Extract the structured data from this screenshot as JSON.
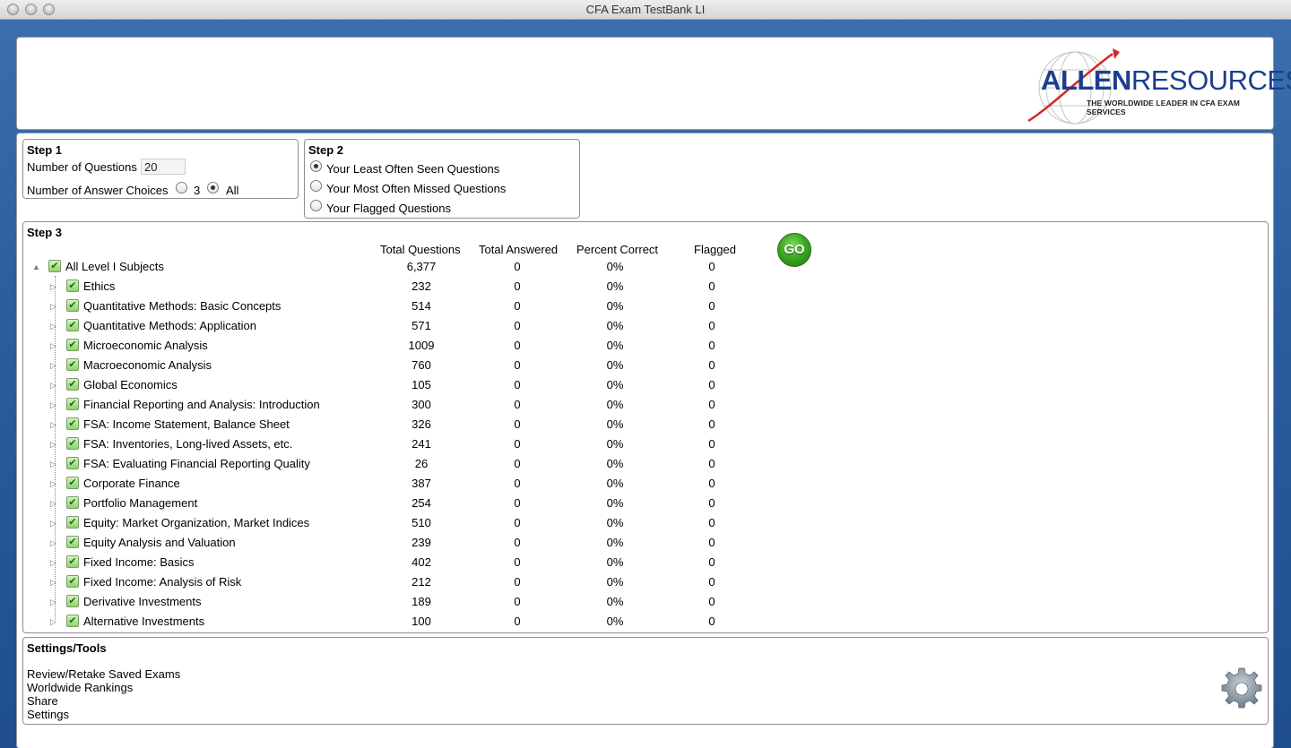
{
  "window": {
    "title": "CFA Exam TestBank LI"
  },
  "logo": {
    "brand_bold": "ALLEN",
    "brand_light": "RESOURCES",
    "tagline": "THE WORLDWIDE LEADER IN CFA EXAM SERVICES"
  },
  "step1": {
    "title": "Step 1",
    "num_questions_label": "Number of Questions",
    "num_questions_value": "20",
    "answer_choices_label": "Number of Answer Choices",
    "choices": [
      {
        "label": "3",
        "selected": false
      },
      {
        "label": "All",
        "selected": true
      }
    ]
  },
  "step2": {
    "title": "Step 2",
    "options": [
      {
        "label": "Your Least Often Seen Questions",
        "selected": true
      },
      {
        "label": "Your Most Often Missed Questions",
        "selected": false
      },
      {
        "label": "Your Flagged Questions",
        "selected": false
      }
    ]
  },
  "step3": {
    "title": "Step 3",
    "columns": [
      "Total Questions",
      "Total Answered",
      "Percent Correct",
      "Flagged"
    ],
    "go_label": "GO",
    "root": {
      "label": "All Level I Subjects",
      "total": "6,377",
      "answered": "0",
      "percent": "0%",
      "flagged": "0",
      "checked": true
    },
    "subjects": [
      {
        "label": "Ethics",
        "total": "232",
        "answered": "0",
        "percent": "0%",
        "flagged": "0",
        "checked": true
      },
      {
        "label": "Quantitative Methods: Basic Concepts",
        "total": "514",
        "answered": "0",
        "percent": "0%",
        "flagged": "0",
        "checked": true
      },
      {
        "label": "Quantitative Methods: Application",
        "total": "571",
        "answered": "0",
        "percent": "0%",
        "flagged": "0",
        "checked": true
      },
      {
        "label": "Microeconomic Analysis",
        "total": "1009",
        "answered": "0",
        "percent": "0%",
        "flagged": "0",
        "checked": true
      },
      {
        "label": "Macroeconomic Analysis",
        "total": "760",
        "answered": "0",
        "percent": "0%",
        "flagged": "0",
        "checked": true
      },
      {
        "label": "Global Economics",
        "total": "105",
        "answered": "0",
        "percent": "0%",
        "flagged": "0",
        "checked": true
      },
      {
        "label": "Financial Reporting and Analysis: Introduction",
        "total": "300",
        "answered": "0",
        "percent": "0%",
        "flagged": "0",
        "checked": true
      },
      {
        "label": "FSA: Income Statement, Balance Sheet",
        "total": "326",
        "answered": "0",
        "percent": "0%",
        "flagged": "0",
        "checked": true
      },
      {
        "label": "FSA: Inventories, Long-lived Assets, etc.",
        "total": "241",
        "answered": "0",
        "percent": "0%",
        "flagged": "0",
        "checked": true
      },
      {
        "label": "FSA: Evaluating Financial Reporting Quality",
        "total": "26",
        "answered": "0",
        "percent": "0%",
        "flagged": "0",
        "checked": true
      },
      {
        "label": "Corporate Finance",
        "total": "387",
        "answered": "0",
        "percent": "0%",
        "flagged": "0",
        "checked": true
      },
      {
        "label": "Portfolio Management",
        "total": "254",
        "answered": "0",
        "percent": "0%",
        "flagged": "0",
        "checked": true
      },
      {
        "label": "Equity: Market Organization, Market Indices",
        "total": "510",
        "answered": "0",
        "percent": "0%",
        "flagged": "0",
        "checked": true
      },
      {
        "label": "Equity Analysis and Valuation",
        "total": "239",
        "answered": "0",
        "percent": "0%",
        "flagged": "0",
        "checked": true
      },
      {
        "label": "Fixed Income: Basics",
        "total": "402",
        "answered": "0",
        "percent": "0%",
        "flagged": "0",
        "checked": true
      },
      {
        "label": "Fixed Income: Analysis of Risk",
        "total": "212",
        "answered": "0",
        "percent": "0%",
        "flagged": "0",
        "checked": true
      },
      {
        "label": "Derivative Investments",
        "total": "189",
        "answered": "0",
        "percent": "0%",
        "flagged": "0",
        "checked": true
      },
      {
        "label": "Alternative Investments",
        "total": "100",
        "answered": "0",
        "percent": "0%",
        "flagged": "0",
        "checked": true
      }
    ]
  },
  "tools": {
    "title": "Settings/Tools",
    "links": [
      "Review/Retake Saved Exams",
      "Worldwide Rankings",
      "Share",
      "Settings"
    ]
  },
  "icons": {
    "expander_open": "▲",
    "expander_closed": "▷",
    "check": "✔",
    "gear": "gear-icon"
  },
  "colors": {
    "go_green": "#3daa24",
    "brand_blue": "#1c3f8e",
    "brand_red": "#d62828"
  }
}
